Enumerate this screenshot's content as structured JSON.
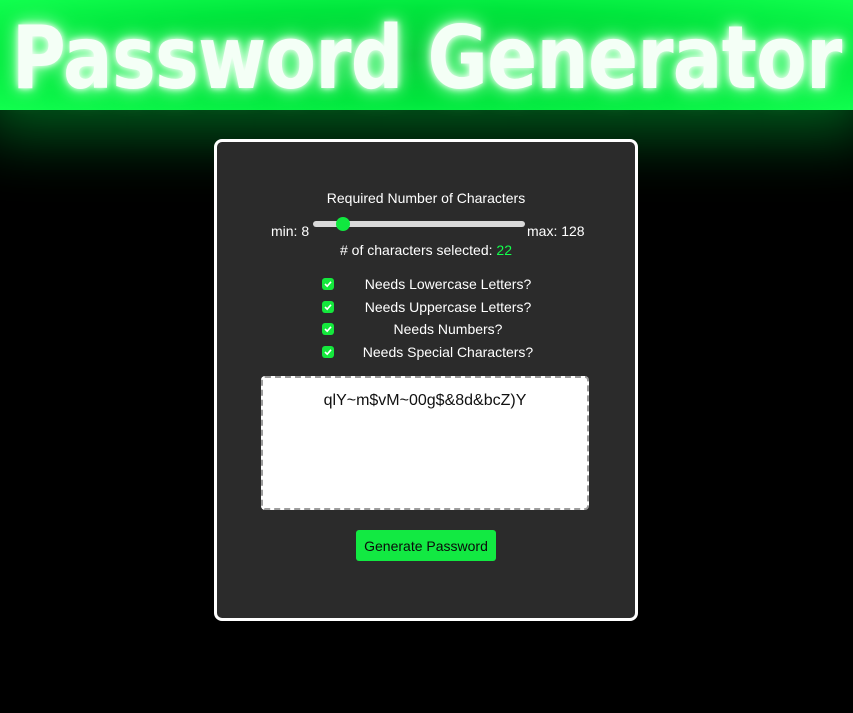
{
  "header": {
    "title": "Password Generator"
  },
  "card": {
    "required_label": "Required Number of Characters",
    "slider": {
      "min_label": "min: 8",
      "max_label": "max: 128",
      "min": 8,
      "max": 128,
      "value": 22
    },
    "selected_prefix": "# of characters selected:",
    "selected_count": "22",
    "options": [
      {
        "label": "Needs Lowercase Letters?",
        "checked": true
      },
      {
        "label": "Needs Uppercase Letters?",
        "checked": true
      },
      {
        "label": "Needs Numbers?",
        "checked": true
      },
      {
        "label": "Needs Special Characters?",
        "checked": true
      }
    ],
    "password_output": "qlY~m$vM~00g$&8d&bcZ)Y",
    "generate_button": "Generate Password"
  },
  "colors": {
    "accent": "#12ff4b",
    "card_bg": "#2b2b2b",
    "page_bg": "#000000"
  }
}
